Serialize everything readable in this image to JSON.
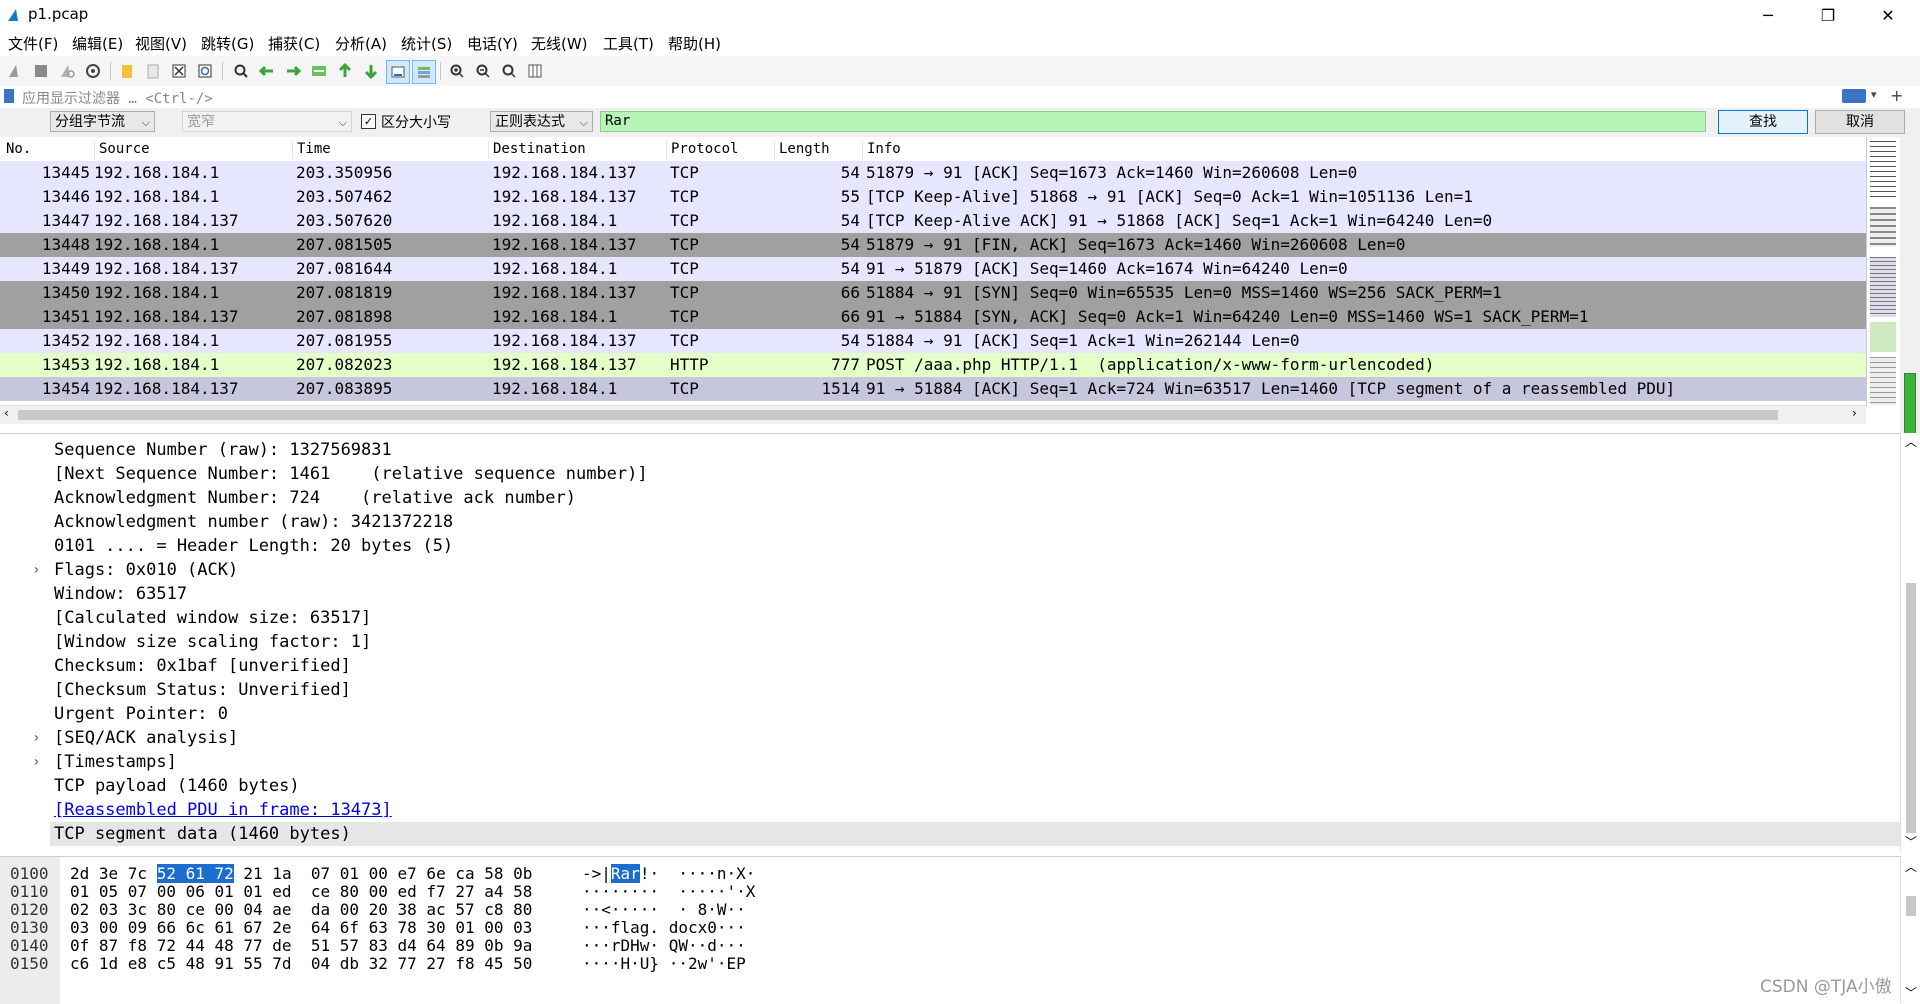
{
  "window": {
    "title": "p1.pcap",
    "minimize": "─",
    "maximize": "❐",
    "close": "✕"
  },
  "menu": [
    "文件(F)",
    "编辑(E)",
    "视图(V)",
    "跳转(G)",
    "捕获(C)",
    "分析(A)",
    "统计(S)",
    "电话(Y)",
    "无线(W)",
    "工具(T)",
    "帮助(H)"
  ],
  "filter": {
    "placeholder": "应用显示过滤器 … <Ctrl-/>"
  },
  "find": {
    "search_in": "分组字节流",
    "charset": "宽窄",
    "case_sensitive_label": "区分大小写",
    "case_sensitive_checked": true,
    "mode": "正则表达式",
    "query": "Rar",
    "find_button": "查找",
    "cancel_button": "取消"
  },
  "packet_list": {
    "columns": [
      "No.",
      "Source",
      "Time",
      "Destination",
      "Protocol",
      "Length",
      "Info"
    ],
    "rows": [
      {
        "no": "13445",
        "src": "192.168.184.1",
        "time": "203.350956",
        "dst": "192.168.184.137",
        "proto": "TCP",
        "len": "54",
        "info": "51879 → 91 [ACK] Seq=1673 Ack=1460 Win=260608 Len=0",
        "bg": "#e7e6ff"
      },
      {
        "no": "13446",
        "src": "192.168.184.1",
        "time": "203.507462",
        "dst": "192.168.184.137",
        "proto": "TCP",
        "len": "55",
        "info": "[TCP Keep-Alive] 51868 → 91 [ACK] Seq=0 Ack=1 Win=1051136 Len=1",
        "bg": "#e7e6ff"
      },
      {
        "no": "13447",
        "src": "192.168.184.137",
        "time": "203.507620",
        "dst": "192.168.184.1",
        "proto": "TCP",
        "len": "54",
        "info": "[TCP Keep-Alive ACK] 91 → 51868 [ACK] Seq=1 Ack=1 Win=64240 Len=0",
        "bg": "#e7e6ff"
      },
      {
        "no": "13448",
        "src": "192.168.184.1",
        "time": "207.081505",
        "dst": "192.168.184.137",
        "proto": "TCP",
        "len": "54",
        "info": "51879 → 91 [FIN, ACK] Seq=1673 Ack=1460 Win=260608 Len=0",
        "bg": "#a0a0a0"
      },
      {
        "no": "13449",
        "src": "192.168.184.137",
        "time": "207.081644",
        "dst": "192.168.184.1",
        "proto": "TCP",
        "len": "54",
        "info": "91 → 51879 [ACK] Seq=1460 Ack=1674 Win=64240 Len=0",
        "bg": "#e7e6ff"
      },
      {
        "no": "13450",
        "src": "192.168.184.1",
        "time": "207.081819",
        "dst": "192.168.184.137",
        "proto": "TCP",
        "len": "66",
        "info": "51884 → 91 [SYN] Seq=0 Win=65535 Len=0 MSS=1460 WS=256 SACK_PERM=1",
        "bg": "#a0a0a0"
      },
      {
        "no": "13451",
        "src": "192.168.184.137",
        "time": "207.081898",
        "dst": "192.168.184.1",
        "proto": "TCP",
        "len": "66",
        "info": "91 → 51884 [SYN, ACK] Seq=0 Ack=1 Win=64240 Len=0 MSS=1460 WS=1 SACK_PERM=1",
        "bg": "#a0a0a0"
      },
      {
        "no": "13452",
        "src": "192.168.184.1",
        "time": "207.081955",
        "dst": "192.168.184.137",
        "proto": "TCP",
        "len": "54",
        "info": "51884 → 91 [ACK] Seq=1 Ack=1 Win=262144 Len=0",
        "bg": "#e7e6ff"
      },
      {
        "no": "13453",
        "src": "192.168.184.1",
        "time": "207.082023",
        "dst": "192.168.184.137",
        "proto": "HTTP",
        "len": "777",
        "info": "POST /aaa.php HTTP/1.1  (application/x-www-form-urlencoded)",
        "bg": "#e4ffc7"
      },
      {
        "no": "13454",
        "src": "192.168.184.137",
        "time": "207.083895",
        "dst": "192.168.184.1",
        "proto": "TCP",
        "len": "1514",
        "info": "91 → 51884 [ACK] Seq=1 Ack=724 Win=63517 Len=1460 [TCP segment of a reassembled PDU]",
        "bg": "#c6c6dc"
      }
    ]
  },
  "details": [
    {
      "text": "Sequence Number (raw): 1327569831",
      "expand": false
    },
    {
      "text": "[Next Sequence Number: 1461    (relative sequence number)]",
      "expand": false
    },
    {
      "text": "Acknowledgment Number: 724    (relative ack number)",
      "expand": false
    },
    {
      "text": "Acknowledgment number (raw): 3421372218",
      "expand": false
    },
    {
      "text": "0101 .... = Header Length: 20 bytes (5)",
      "expand": false
    },
    {
      "text": "Flags: 0x010 (ACK)",
      "expand": true
    },
    {
      "text": "Window: 63517",
      "expand": false
    },
    {
      "text": "[Calculated window size: 63517]",
      "expand": false
    },
    {
      "text": "[Window size scaling factor: 1]",
      "expand": false
    },
    {
      "text": "Checksum: 0x1baf [unverified]",
      "expand": false
    },
    {
      "text": "[Checksum Status: Unverified]",
      "expand": false
    },
    {
      "text": "Urgent Pointer: 0",
      "expand": false
    },
    {
      "text": "[SEQ/ACK analysis]",
      "expand": true
    },
    {
      "text": "[Timestamps]",
      "expand": true
    },
    {
      "text": "TCP payload (1460 bytes)",
      "expand": false
    },
    {
      "text": "[Reassembled PDU in frame: 13473]",
      "expand": false,
      "link": true
    },
    {
      "text": "TCP segment data (1460 bytes)",
      "expand": false,
      "selected": true
    }
  ],
  "hex": [
    {
      "offset": "0100",
      "bytes_a": "2d 3e 7c",
      "bytes_hl": "52 61 72",
      "bytes_b": "21 1a  07 01 00 e7 6e ca 58 0b",
      "ascii_a": "->|",
      "ascii_hl": "Rar",
      "ascii_b": "!·  ····n·X·"
    },
    {
      "offset": "0110",
      "bytes_a": "01 05 07 00 06 01 01 ed  ce 80 00 ed f7 27 a4 58",
      "bytes_hl": "",
      "bytes_b": "",
      "ascii_a": "········  ·····'·X",
      "ascii_hl": "",
      "ascii_b": ""
    },
    {
      "offset": "0120",
      "bytes_a": "02 03 3c 80 ce 00 04 ae  da 00 20 38 ac 57 c8 80",
      "bytes_hl": "",
      "bytes_b": "",
      "ascii_a": "··<·····  · 8·W··",
      "ascii_hl": "",
      "ascii_b": ""
    },
    {
      "offset": "0130",
      "bytes_a": "03 00 09 66 6c 61 67 2e  64 6f 63 78 30 01 00 03",
      "bytes_hl": "",
      "bytes_b": "",
      "ascii_a": "···flag. docx0···",
      "ascii_hl": "",
      "ascii_b": ""
    },
    {
      "offset": "0140",
      "bytes_a": "0f 87 f8 72 44 48 77 de  51 57 83 d4 64 89 0b 9a",
      "bytes_hl": "",
      "bytes_b": "",
      "ascii_a": "···rDHw· QW··d···",
      "ascii_hl": "",
      "ascii_b": ""
    },
    {
      "offset": "0150",
      "bytes_a": "c6 1d e8 c5 48 91 55 7d  04 db 32 77 27 f8 45 50",
      "bytes_hl": "",
      "bytes_b": "",
      "ascii_a": "····H·U} ··2w'·EP",
      "ascii_hl": "",
      "ascii_b": ""
    }
  ],
  "watermark": "CSDN @TJA小傲"
}
